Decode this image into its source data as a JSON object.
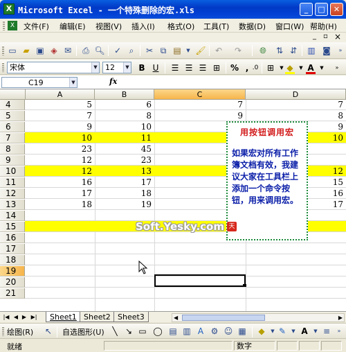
{
  "window": {
    "app_icon_label": "X",
    "title": "Microsoft Excel - 一个特殊删除的宏.xls",
    "controls": {
      "minimize": "_",
      "maximize": "□",
      "close": "✕"
    }
  },
  "menu": {
    "items": [
      "文件(F)",
      "编辑(E)",
      "视图(V)",
      "插入(I)",
      "格式(O)",
      "工具(T)",
      "数据(D)",
      "窗口(W)",
      "帮助(H)"
    ],
    "doc_controls": {
      "minimize": "_",
      "restore": "▫",
      "close": "×"
    }
  },
  "toolbar_icons": [
    "new-icon",
    "open-icon",
    "save-icon",
    "permission-icon",
    "email-icon",
    "print-icon",
    "print-preview-icon",
    "spelling-icon",
    "research-icon",
    "cut-icon",
    "copy-icon",
    "paste-icon",
    "format-painter-icon",
    "undo-icon",
    "redo-icon",
    "hyperlink-icon",
    "sort-ascending-icon",
    "sort-descending-icon",
    "chart-wizard-icon",
    "camera-icon"
  ],
  "format": {
    "font": "宋体",
    "size": "12",
    "bold": "B",
    "underline": "U",
    "percent": "%",
    "comma": ",",
    "decimal_inc": ".0",
    "decimal_dec": ".00"
  },
  "formula_bar": {
    "name_box": "C19",
    "fx": "fx",
    "content": ""
  },
  "columns": [
    "A",
    "B",
    "C",
    "D"
  ],
  "active_column": "C",
  "rows": [
    {
      "num": "4",
      "a": "5",
      "b": "6",
      "c": "7",
      "d": "7",
      "highlight": false
    },
    {
      "num": "5",
      "a": "7",
      "b": "8",
      "c": "9",
      "d": "8",
      "highlight": false
    },
    {
      "num": "6",
      "a": "9",
      "b": "10",
      "c": "",
      "d": "9",
      "highlight": false
    },
    {
      "num": "7",
      "a": "10",
      "b": "11",
      "c": "",
      "d": "10",
      "highlight": true
    },
    {
      "num": "8",
      "a": "23",
      "b": "45",
      "c": "",
      "d": "",
      "highlight": false
    },
    {
      "num": "9",
      "a": "12",
      "b": "23",
      "c": "",
      "d": "",
      "highlight": false
    },
    {
      "num": "10",
      "a": "12",
      "b": "13",
      "c": "",
      "d": "12",
      "highlight": true
    },
    {
      "num": "11",
      "a": "16",
      "b": "17",
      "c": "",
      "d": "15",
      "highlight": false
    },
    {
      "num": "12",
      "a": "17",
      "b": "18",
      "c": "",
      "d": "16",
      "highlight": false
    },
    {
      "num": "13",
      "a": "18",
      "b": "19",
      "c": "",
      "d": "17",
      "highlight": false
    },
    {
      "num": "14",
      "a": "",
      "b": "",
      "c": "",
      "d": "",
      "highlight": false
    },
    {
      "num": "15",
      "a": "",
      "b": "",
      "c": "",
      "d": "",
      "highlight": true
    },
    {
      "num": "16",
      "a": "",
      "b": "",
      "c": "",
      "d": "",
      "highlight": false
    },
    {
      "num": "17",
      "a": "",
      "b": "",
      "c": "",
      "d": "",
      "highlight": false
    },
    {
      "num": "18",
      "a": "",
      "b": "",
      "c": "",
      "d": "",
      "highlight": false
    },
    {
      "num": "19",
      "a": "",
      "b": "",
      "c": "",
      "d": "",
      "highlight": false
    },
    {
      "num": "20",
      "a": "",
      "b": "",
      "c": "",
      "d": "",
      "highlight": false
    },
    {
      "num": "21",
      "a": "",
      "b": "",
      "c": "",
      "d": "",
      "highlight": false
    }
  ],
  "active_row": "19",
  "selected_cell": "C19",
  "note": {
    "title": "用按钮调用宏",
    "body": "如果宏对所有工作簿文档有效，我建议大家在工具栏上添加一个命令按钮，用来调用宏。"
  },
  "watermark": {
    "text": "Soft.Yesky.com",
    "badge": "天"
  },
  "sheets": [
    "Sheet1",
    "Sheet2",
    "Sheet3"
  ],
  "active_sheet": "Sheet1",
  "draw_toolbar": {
    "draw_label": "绘图(R)",
    "autoshapes_label": "自选图形(U)"
  },
  "status": {
    "ready": "就绪",
    "num_lock": "数字"
  },
  "colors": {
    "highlight": "#ffff00",
    "note_border": "#1a8a3a",
    "note_title": "#d21a1a",
    "note_body": "#0a1ea8",
    "title_bar": "#0039c6"
  }
}
